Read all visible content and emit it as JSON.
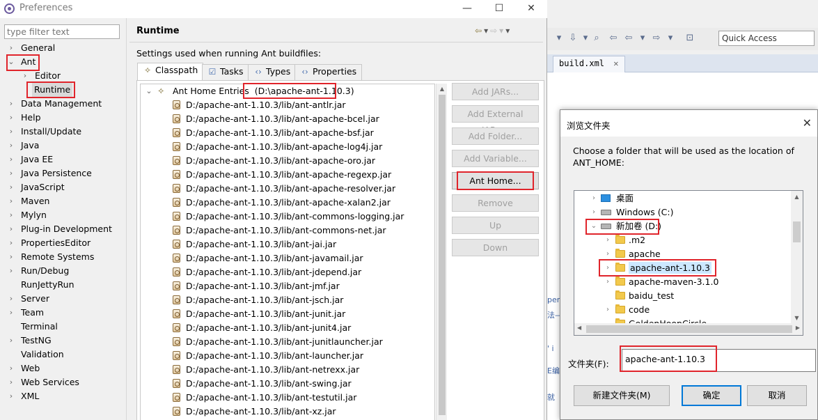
{
  "preferences": {
    "title": "Preferences",
    "filter_placeholder": "type filter text",
    "nav": [
      "General",
      "Ant",
      "Editor",
      "Runtime",
      "Data Management",
      "Help",
      "Install/Update",
      "Java",
      "Java EE",
      "Java Persistence",
      "JavaScript",
      "Maven",
      "Mylyn",
      "Plug-in Development",
      "PropertiesEditor",
      "Remote Systems",
      "Run/Debug",
      "RunJettyRun",
      "Server",
      "Team",
      "Terminal",
      "TestNG",
      "Validation",
      "Web",
      "Web Services",
      "XML"
    ],
    "page_title": "Runtime",
    "page_description": "Settings used when running Ant buildfiles:",
    "tabs": [
      "Classpath",
      "Tasks",
      "Types",
      "Properties"
    ],
    "ant_home_label": "Ant Home Entries",
    "ant_home_path": "(D:\\apache-ant-1.10.3)",
    "jars": [
      "D:/apache-ant-1.10.3/lib/ant-antlr.jar",
      "D:/apache-ant-1.10.3/lib/ant-apache-bcel.jar",
      "D:/apache-ant-1.10.3/lib/ant-apache-bsf.jar",
      "D:/apache-ant-1.10.3/lib/ant-apache-log4j.jar",
      "D:/apache-ant-1.10.3/lib/ant-apache-oro.jar",
      "D:/apache-ant-1.10.3/lib/ant-apache-regexp.jar",
      "D:/apache-ant-1.10.3/lib/ant-apache-resolver.jar",
      "D:/apache-ant-1.10.3/lib/ant-apache-xalan2.jar",
      "D:/apache-ant-1.10.3/lib/ant-commons-logging.jar",
      "D:/apache-ant-1.10.3/lib/ant-commons-net.jar",
      "D:/apache-ant-1.10.3/lib/ant-jai.jar",
      "D:/apache-ant-1.10.3/lib/ant-javamail.jar",
      "D:/apache-ant-1.10.3/lib/ant-jdepend.jar",
      "D:/apache-ant-1.10.3/lib/ant-jmf.jar",
      "D:/apache-ant-1.10.3/lib/ant-jsch.jar",
      "D:/apache-ant-1.10.3/lib/ant-junit.jar",
      "D:/apache-ant-1.10.3/lib/ant-junit4.jar",
      "D:/apache-ant-1.10.3/lib/ant-junitlauncher.jar",
      "D:/apache-ant-1.10.3/lib/ant-launcher.jar",
      "D:/apache-ant-1.10.3/lib/ant-netrexx.jar",
      "D:/apache-ant-1.10.3/lib/ant-swing.jar",
      "D:/apache-ant-1.10.3/lib/ant-testutil.jar",
      "D:/apache-ant-1.10.3/lib/ant-xz.jar"
    ],
    "buttons": [
      "Add JARs...",
      "Add External JARs...",
      "Add Folder...",
      "Add Variable...",
      "Ant Home...",
      "Remove",
      "Up",
      "Down"
    ]
  },
  "background": {
    "quick_access": "Quick Access",
    "editor_tab": "build.xml"
  },
  "dialog": {
    "title": "浏览文件夹",
    "prompt": "Choose a folder that will be used as the location of ANT_HOME:",
    "tree": [
      "桌面",
      "Windows (C:)",
      "新加卷 (D:)",
      ".m2",
      "apache",
      "apache-ant-1.10.3",
      "apache-maven-3.1.0",
      "baidu_test",
      "code",
      "GoldenHoopCircle"
    ],
    "folder_label": "文件夹(F):",
    "folder_value": "apache-ant-1.10.3",
    "new_folder": "新建文件夹(M)",
    "ok": "确定",
    "cancel": "取消"
  },
  "colors": {
    "highlight": "#e0242b",
    "primary_border": "#0078d7"
  }
}
